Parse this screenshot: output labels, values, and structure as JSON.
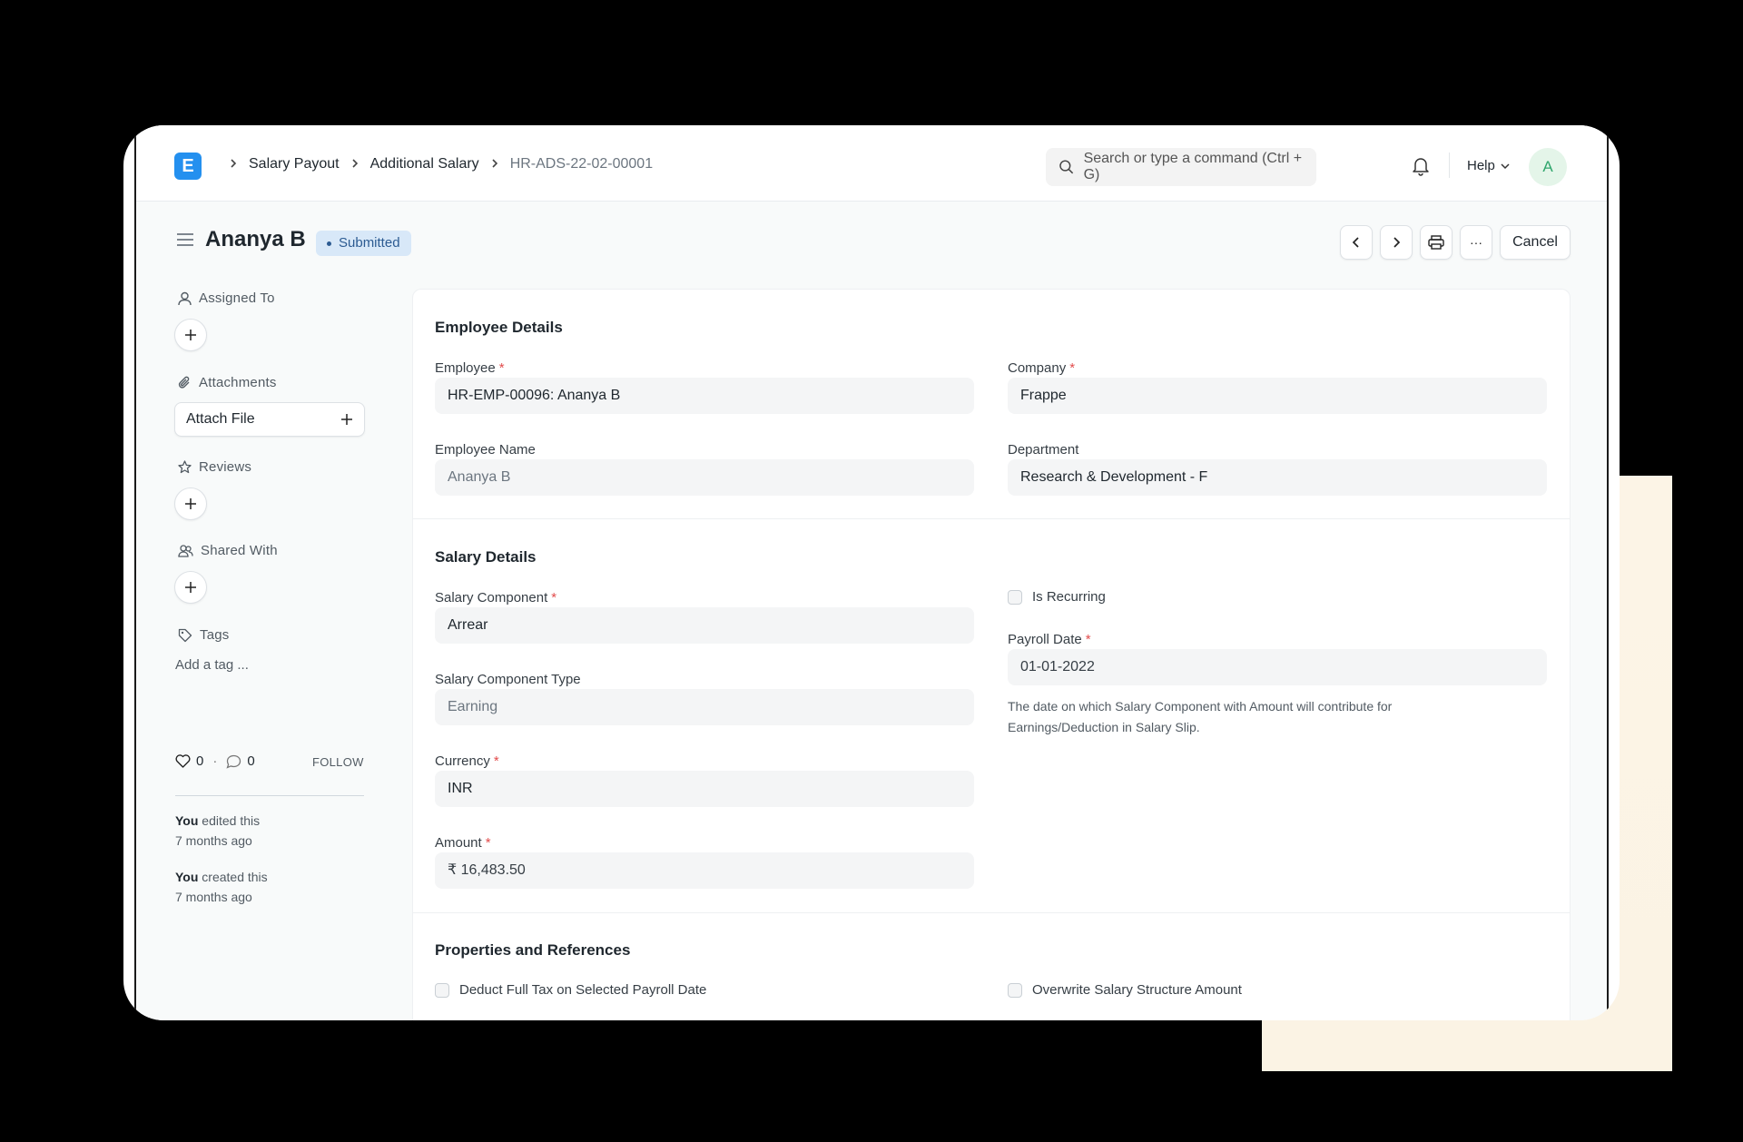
{
  "navbar": {
    "logo_letter": "E",
    "breadcrumbs": [
      "Salary Payout",
      "Additional Salary",
      "HR-ADS-22-02-00001"
    ],
    "search_placeholder": "Search or type a command (Ctrl + G)",
    "help_label": "Help",
    "avatar_initial": "A"
  },
  "page": {
    "title": "Ananya B",
    "status": "Submitted",
    "cancel_label": "Cancel",
    "more_label": "···"
  },
  "sidebar": {
    "assigned_to": "Assigned To",
    "attachments": "Attachments",
    "attach_file": "Attach File",
    "reviews": "Reviews",
    "shared_with": "Shared With",
    "tags": "Tags",
    "add_tag": "Add a tag ...",
    "likes_count": "0",
    "comments_count": "0",
    "likes_sep": "·",
    "follow_label": "FOLLOW",
    "activity": [
      {
        "who": "You",
        "action": "edited this",
        "when": "7 months ago"
      },
      {
        "who": "You",
        "action": "created this",
        "when": "7 months ago"
      }
    ]
  },
  "form": {
    "employee_details": {
      "title": "Employee Details",
      "employee_label": "Employee",
      "employee_value": "HR-EMP-00096: Ananya B",
      "company_label": "Company",
      "company_value": "Frappe",
      "employee_name_label": "Employee Name",
      "employee_name_value": "Ananya B",
      "department_label": "Department",
      "department_value": "Research & Development - F"
    },
    "salary_details": {
      "title": "Salary Details",
      "component_label": "Salary Component",
      "component_value": "Arrear",
      "is_recurring_label": "Is Recurring",
      "payroll_date_label": "Payroll Date",
      "payroll_date_value": "01-01-2022",
      "payroll_help": "The date on which Salary Component with Amount will contribute for Earnings/Deduction in Salary Slip.",
      "component_type_label": "Salary Component Type",
      "component_type_value": "Earning",
      "currency_label": "Currency",
      "currency_value": "INR",
      "amount_label": "Amount",
      "amount_value": "₹ 16,483.50"
    },
    "properties": {
      "title": "Properties and References",
      "deduct_full_tax_label": "Deduct Full Tax on Selected Payroll Date",
      "overwrite_label": "Overwrite Salary Structure Amount"
    },
    "required_mark": "*"
  },
  "colors": {
    "accent": "#2490ef",
    "status_bg": "#d8e8f8",
    "status_fg": "#2c5b92",
    "required": "#e24c4c",
    "avatar_fg": "#30a66d"
  }
}
